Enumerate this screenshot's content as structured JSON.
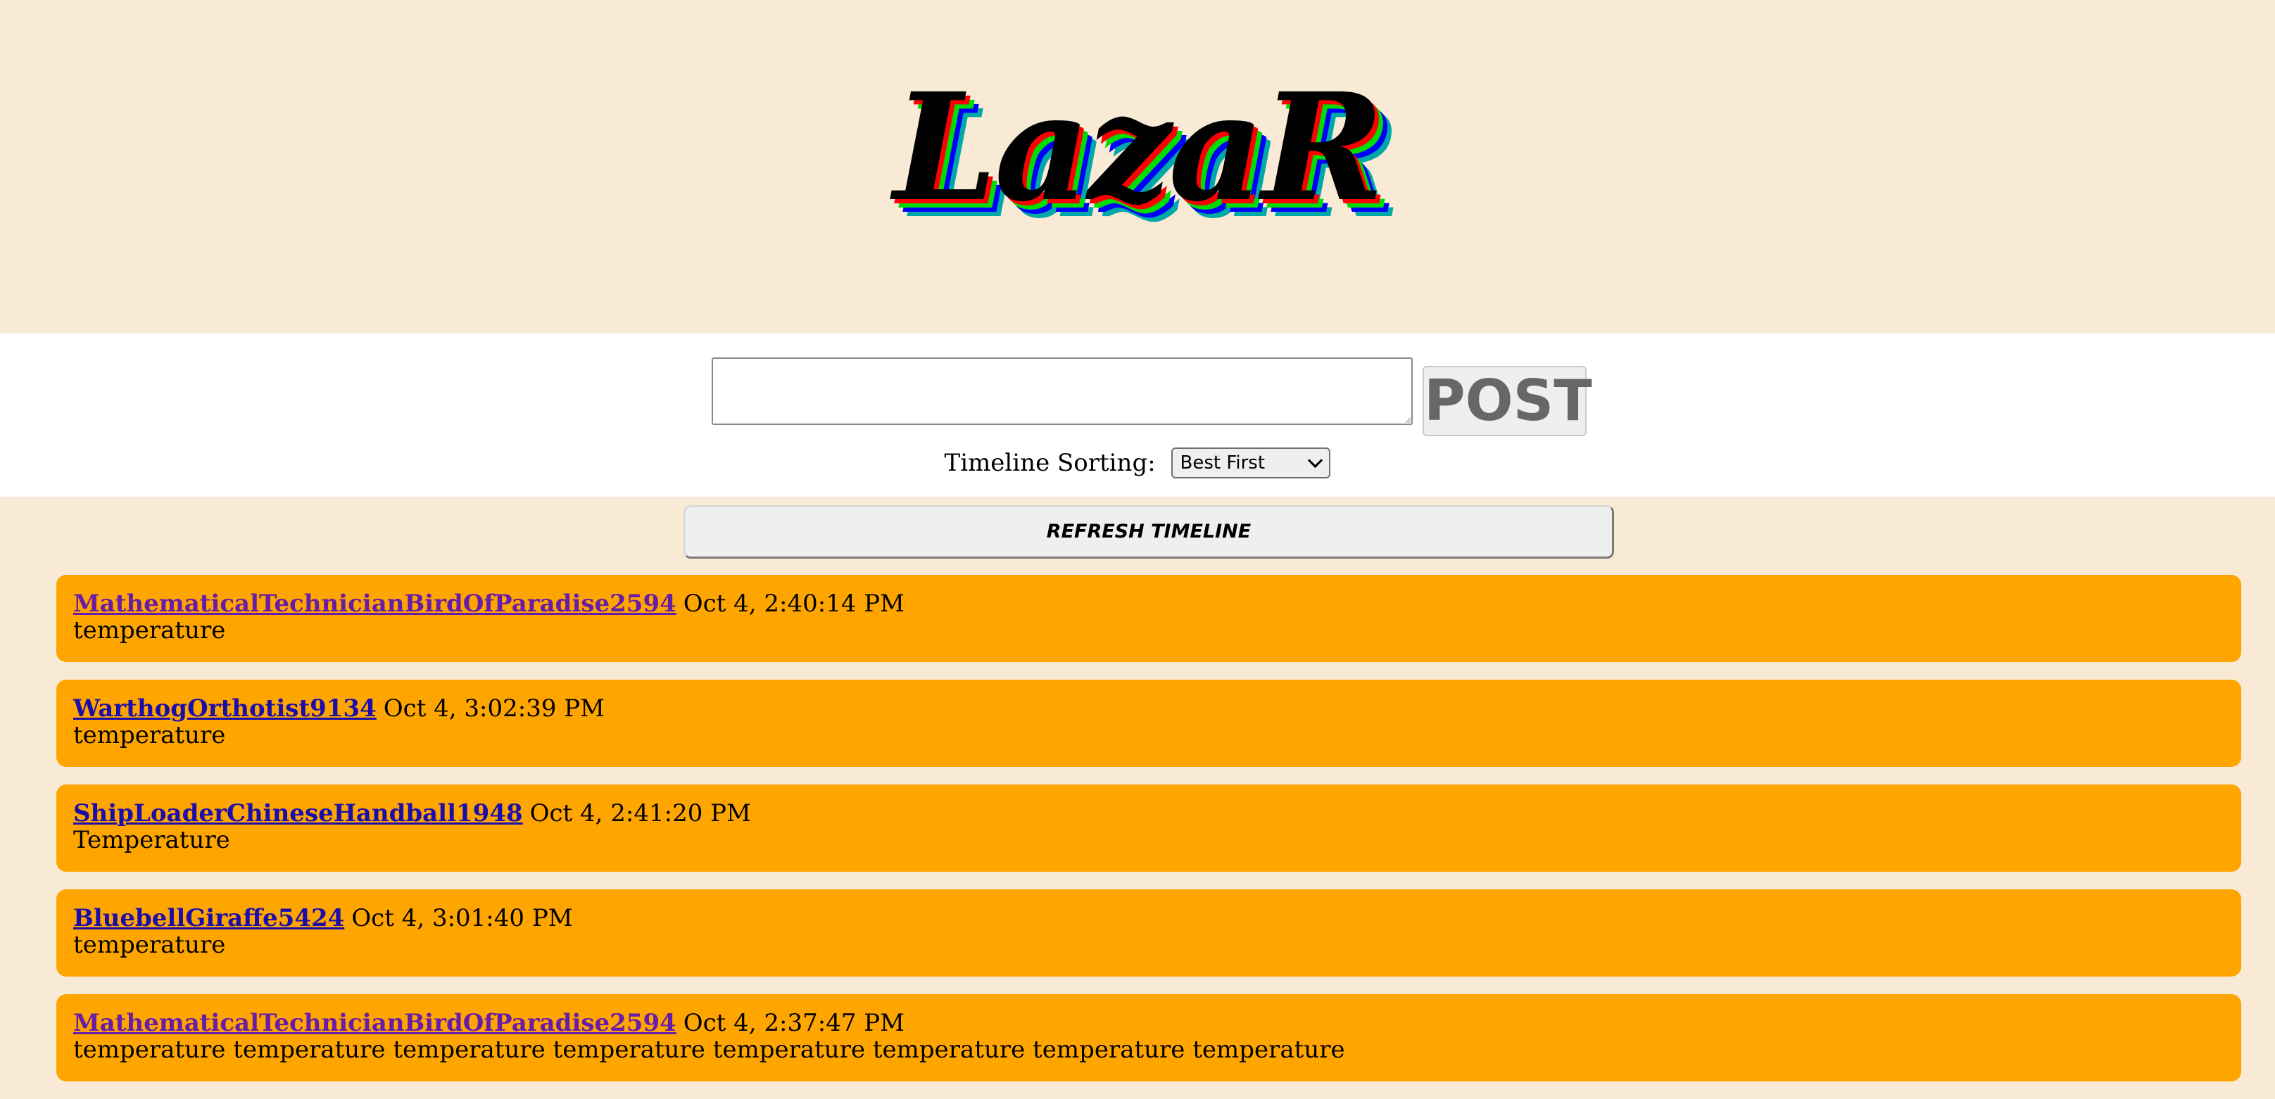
{
  "header": {
    "logo_text": "LazaR",
    "logo_shadow_colors": [
      "#ff0000",
      "#00dd00",
      "#0000ff",
      "#00a8a8"
    ]
  },
  "compose": {
    "input_value": "",
    "post_label": "POST",
    "sort_label": "Timeline Sorting:",
    "sort_selected": "Best First"
  },
  "refresh_label": "REFRESH TIMELINE",
  "colors": {
    "background": "#f9ead6",
    "card": "#ffa500",
    "link": "#1a0dab",
    "visited_link": "#681da8"
  },
  "posts": [
    {
      "author": "MathematicalTechnicianBirdOfParadise2594",
      "time": "Oct 4, 2:40:14 PM",
      "body": "temperature"
    },
    {
      "author": "WarthogOrthotist9134",
      "time": "Oct 4, 3:02:39 PM",
      "body": "temperature"
    },
    {
      "author": "ShipLoaderChineseHandball1948",
      "time": "Oct 4, 2:41:20 PM",
      "body": "Temperature"
    },
    {
      "author": "BluebellGiraffe5424",
      "time": "Oct 4, 3:01:40 PM",
      "body": "temperature"
    },
    {
      "author": "MathematicalTechnicianBirdOfParadise2594",
      "time": "Oct 4, 2:37:47 PM",
      "body": "temperature temperature temperature temperature temperature temperature temperature temperature"
    }
  ]
}
